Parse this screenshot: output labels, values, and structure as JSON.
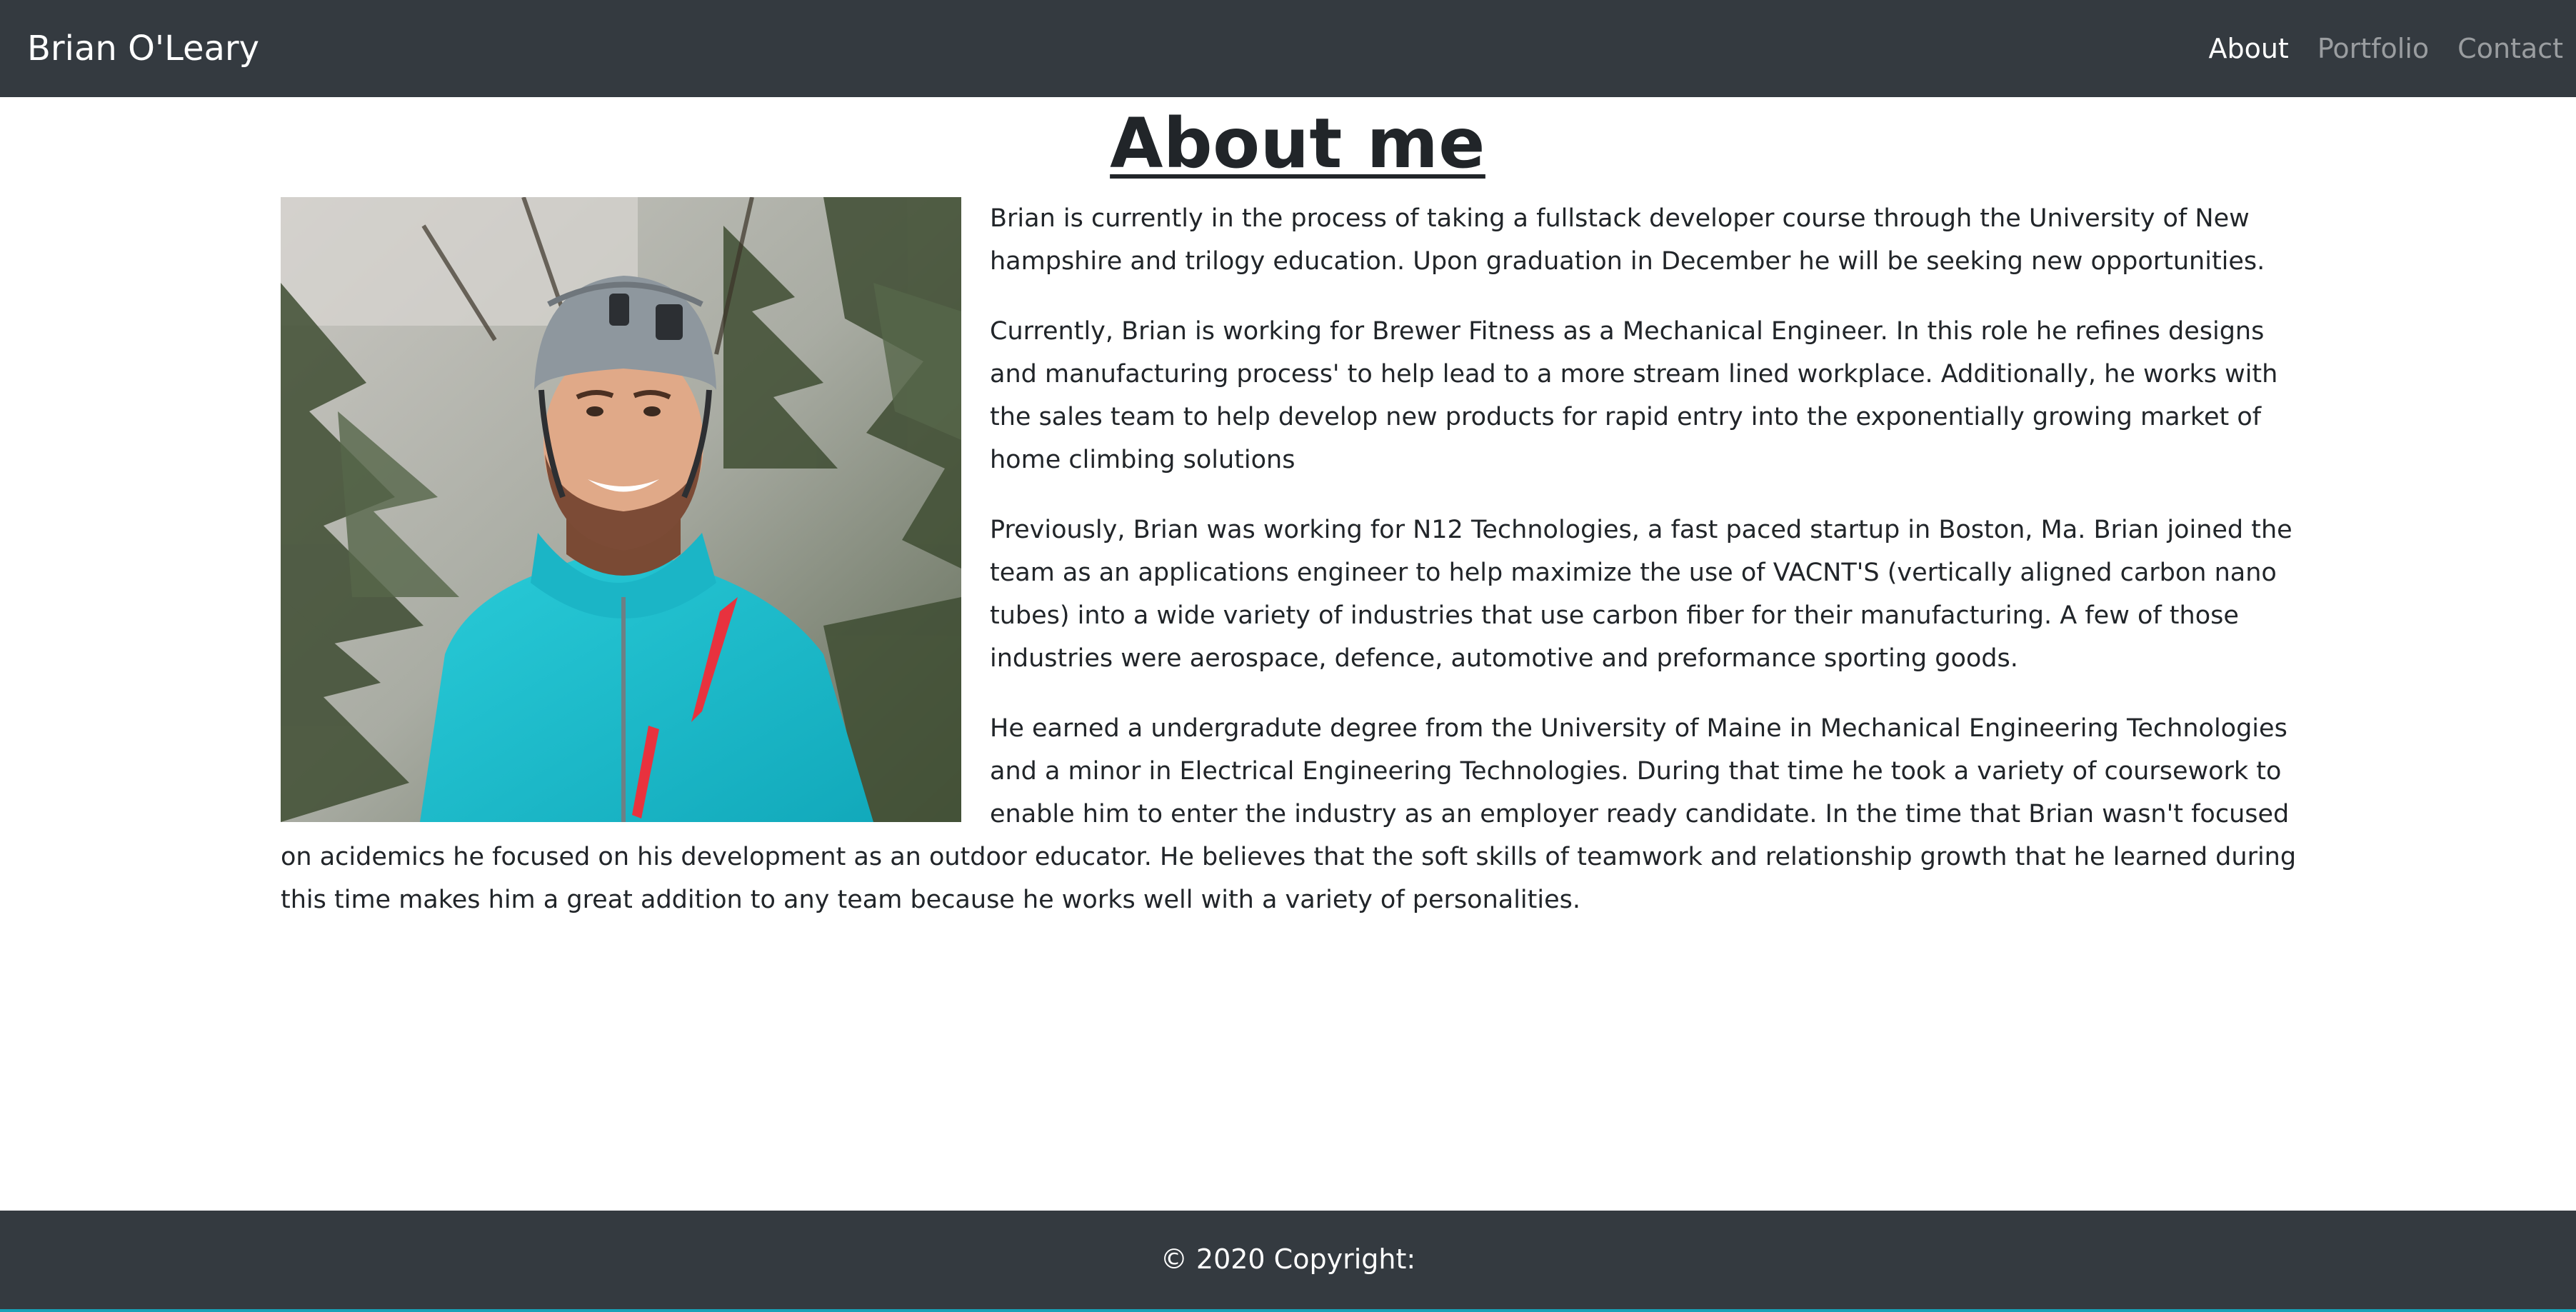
{
  "navbar": {
    "brand": "Brian O'Leary",
    "links": [
      {
        "label": "About",
        "active": true
      },
      {
        "label": "Portfolio",
        "active": false
      },
      {
        "label": "Contact",
        "active": false
      }
    ]
  },
  "main": {
    "title": "About me",
    "photo_alt": "Brian wearing a climbing helmet and teal jacket",
    "paragraphs": [
      "Brian is currently in the process of taking a fullstack developer course through the University of New hampshire and trilogy education. Upon graduation in December he will be seeking new opportunities.",
      "Currently, Brian is working for Brewer Fitness as a Mechanical Engineer. In this role he refines designs and manufacturing process' to help lead to a more stream lined workplace. Additionally, he works with the sales team to help develop new products for rapid entry into the exponentially growing market of home climbing solutions",
      "Previously, Brian was working for N12 Technologies, a fast paced startup in Boston, Ma. Brian joined the team as an applications engineer to help maximize the use of VACNT'S (vertically aligned carbon nano tubes) into a wide variety of industries that use carbon fiber for their manufacturing. A few of those industries were aerospace, defence, automotive and preformance sporting goods.",
      "He earned a undergradute degree from the University of Maine in Mechanical Engineering Technologies and a minor in Electrical Engineering Technologies. During that time he took a variety of coursework to enable him to enter the industry as an employer ready candidate. In the time that Brian wasn't focused on acidemics he focused on his development as an outdoor educator. He believes that the soft skills of teamwork and relationship growth that he learned during this time makes him a great addition to any team because he works well with a variety of personalities."
    ]
  },
  "footer": {
    "copyright": "© 2020 Copyright:"
  },
  "colors": {
    "navbar_bg": "#343a40",
    "nav_active": "#ffffff",
    "nav_inactive": "#8a8d91",
    "jacket": "#1fbfcf",
    "helmet": "#8e979e"
  }
}
